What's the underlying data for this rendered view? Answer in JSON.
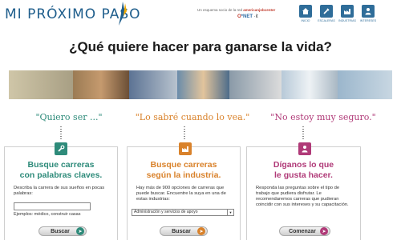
{
  "header": {
    "logo_text": "MI PRÓXIMO PASO",
    "tagline_prefix": "Un esquema socio de la red ",
    "tagline_brand": "americanjobcenter",
    "onet_o": "O",
    "onet_n": "*NET",
    "onet_suffix": " ·it",
    "nav": [
      {
        "label": "INICIO",
        "icon": "home-icon"
      },
      {
        "label": "ESCALERAS",
        "icon": "tools-icon"
      },
      {
        "label": "INDUSTRIAS",
        "icon": "factory-icon"
      },
      {
        "label": "INTERESES",
        "icon": "person-icon"
      }
    ]
  },
  "headline": "¿Qué quiere hacer para ganarse la vida?",
  "columns": [
    {
      "quote": "\"Quiero ser ...\"",
      "icon": "wrench-icon",
      "title_line1": "Busque carreras",
      "title_line2": "con palabras claves.",
      "description": "Describa la carrera de sus sueños en pocas palabras:",
      "input_value": "",
      "example": "Ejemplos: médico, construir casas",
      "button_label": "Buscar",
      "accent": "#2e8b7a"
    },
    {
      "quote": "\"Lo sabré cuando lo vea.\"",
      "icon": "factory-icon",
      "title_line1": "Busque carreras",
      "title_line2": "según la industria.",
      "description": "Hay más de 900 opciones de carreras que puede buscar. Encuentre la suya en una de estas industrias:",
      "select_value": "Administración y servicios de apoyo",
      "button_label": "Buscar",
      "accent": "#d9822b"
    },
    {
      "quote": "\"No estoy muy seguro.\"",
      "icon": "person-icon",
      "title_line1": "Díganos lo que",
      "title_line2": "le gusta hacer.",
      "description": "Responda las preguntas sobre el tipo de trabajo que pudiera disfrutar. Le recomendaremos carreras que pudieran coincidir con sus intereses y su capacitación.",
      "button_label": "Comenzar",
      "accent": "#b03a78"
    }
  ]
}
